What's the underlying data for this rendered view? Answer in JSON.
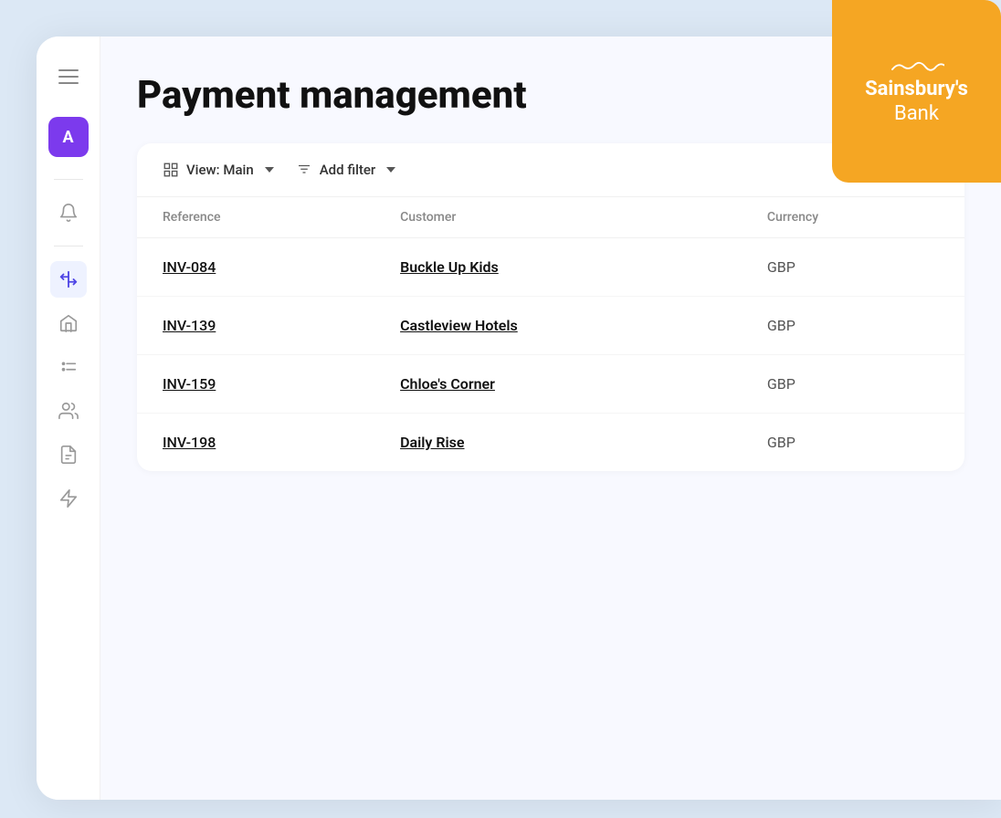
{
  "logo": {
    "line1": "Sainsbury's",
    "line2": "Bank"
  },
  "page": {
    "title": "Payment management"
  },
  "sidebar": {
    "avatar_label": "A",
    "hamburger_aria": "Menu",
    "items": [
      {
        "name": "notifications",
        "icon": "🔔",
        "active": false
      },
      {
        "name": "filter",
        "icon": "⚡",
        "active": true
      },
      {
        "name": "home",
        "icon": "🏠",
        "active": false
      },
      {
        "name": "list-check",
        "icon": "✅",
        "active": false
      },
      {
        "name": "team",
        "icon": "👥",
        "active": false
      },
      {
        "name": "document",
        "icon": "📄",
        "active": false
      },
      {
        "name": "lightning",
        "icon": "⚡",
        "active": false
      }
    ]
  },
  "toolbar": {
    "view_label": "View: Main",
    "view_icon": "⊞",
    "filter_label": "Add filter",
    "filter_icon": "≡"
  },
  "table": {
    "columns": [
      "Reference",
      "Customer",
      "Currency"
    ],
    "rows": [
      {
        "reference": "INV-084",
        "customer": "Buckle Up Kids",
        "currency": "GBP"
      },
      {
        "reference": "INV-139",
        "customer": "Castleview Hotels",
        "currency": "GBP"
      },
      {
        "reference": "INV-159",
        "customer": "Chloe's Corner",
        "currency": "GBP"
      },
      {
        "reference": "INV-198",
        "customer": "Daily Rise",
        "currency": "GBP"
      }
    ]
  }
}
